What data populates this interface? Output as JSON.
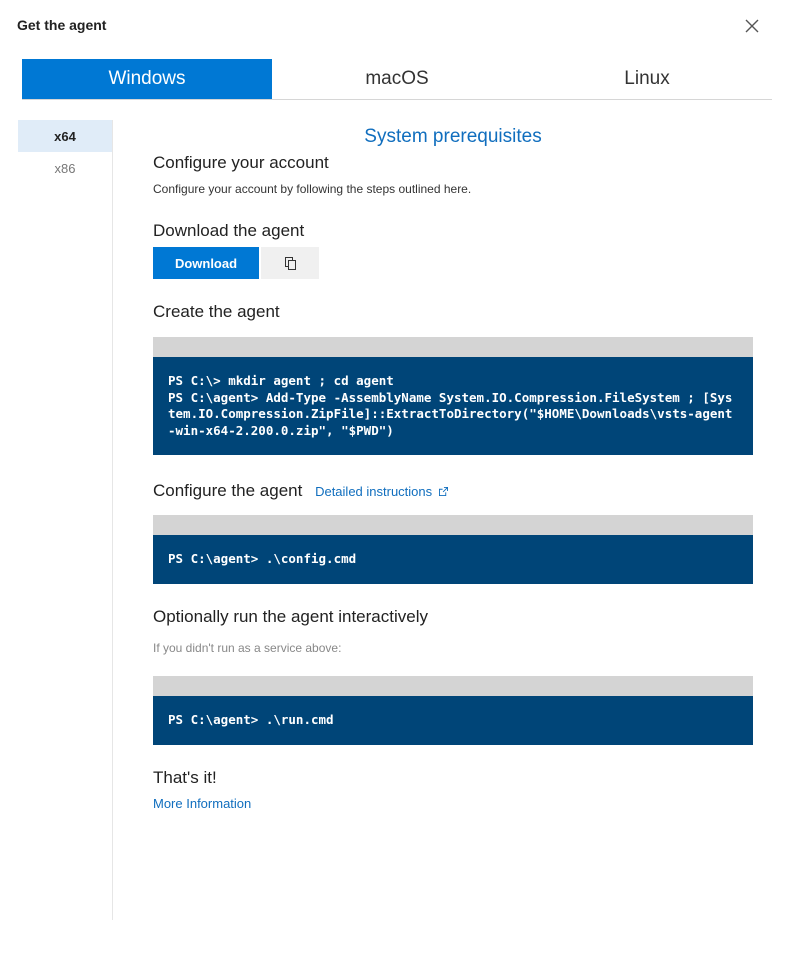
{
  "dialog": {
    "title": "Get the agent"
  },
  "os_tabs": [
    {
      "label": "Windows",
      "active": true
    },
    {
      "label": "macOS",
      "active": false
    },
    {
      "label": "Linux",
      "active": false
    }
  ],
  "arch_tabs": [
    {
      "label": "x64",
      "active": true
    },
    {
      "label": "x86",
      "active": false
    }
  ],
  "content": {
    "prereq_link": "System prerequisites",
    "configure_account": {
      "heading": "Configure your account",
      "description": "Configure your account by following the steps outlined here."
    },
    "download_agent": {
      "heading": "Download the agent",
      "button_label": "Download"
    },
    "create_agent": {
      "heading": "Create the agent",
      "code_lines": [
        "PS C:\\> mkdir agent ; cd agent",
        "PS C:\\agent> Add-Type -AssemblyName System.IO.Compression.FileSystem ; [System.IO.Compression.ZipFile]::ExtractToDirectory(\"$HOME\\Downloads\\vsts-agent-win-x64-2.200.0.zip\", \"$PWD\")"
      ]
    },
    "configure_agent": {
      "heading": "Configure the agent",
      "link_label": "Detailed instructions",
      "code_lines": [
        "PS C:\\agent> .\\config.cmd"
      ]
    },
    "run_agent": {
      "heading": "Optionally run the agent interactively",
      "description": "If you didn't run as a service above:",
      "code_lines": [
        "PS C:\\agent> .\\run.cmd"
      ]
    },
    "done": {
      "heading": "That's it!",
      "link_label": "More Information"
    }
  },
  "colors": {
    "accent": "#0078d4",
    "link": "#106ebe",
    "code_background": "#004578",
    "code_header": "#d4d4d4",
    "arch_selected": "#e0ecf8"
  },
  "icons": {
    "close": "close-icon",
    "copy": "copy-icon",
    "external_link": "external-link-icon"
  }
}
